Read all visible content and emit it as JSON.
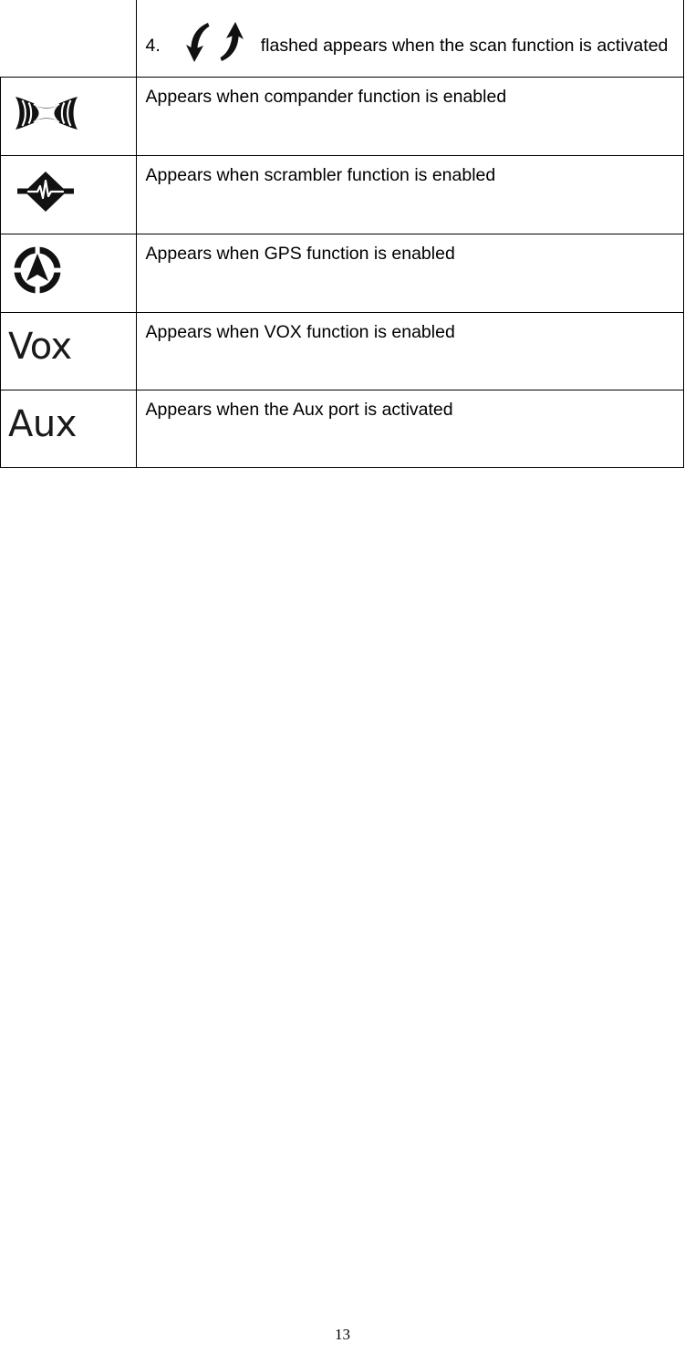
{
  "document": {
    "page_number": "13"
  },
  "table": {
    "rows": [
      {
        "icon_name": "scan-arrows-icon",
        "icon_kind": "svg-scan",
        "icon_text": "",
        "number_label": "4.",
        "description": "flashed appears when the scan function is activated",
        "numbered": true
      },
      {
        "icon_name": "compander-icon",
        "icon_kind": "svg-compander",
        "icon_text": "",
        "number_label": "",
        "description": "Appears when compander function is enabled",
        "numbered": false
      },
      {
        "icon_name": "scrambler-icon",
        "icon_kind": "svg-scrambler",
        "icon_text": "",
        "number_label": "",
        "description": "Appears when scrambler function is enabled",
        "numbered": false
      },
      {
        "icon_name": "gps-icon",
        "icon_kind": "svg-gps",
        "icon_text": "",
        "number_label": "",
        "description": "Appears when GPS function is enabled",
        "numbered": false
      },
      {
        "icon_name": "vox-icon",
        "icon_kind": "text",
        "icon_text": "Vox",
        "number_label": "",
        "description": "Appears when VOX function is enabled",
        "numbered": false
      },
      {
        "icon_name": "aux-icon",
        "icon_kind": "text",
        "icon_text": "Aux",
        "number_label": "",
        "description": "Appears when the Aux port is activated",
        "numbered": false
      }
    ]
  },
  "colors": {
    "ink": "#000000",
    "icon_ink": "#1a1a1a",
    "rule": "#000000",
    "paper": "#ffffff"
  }
}
